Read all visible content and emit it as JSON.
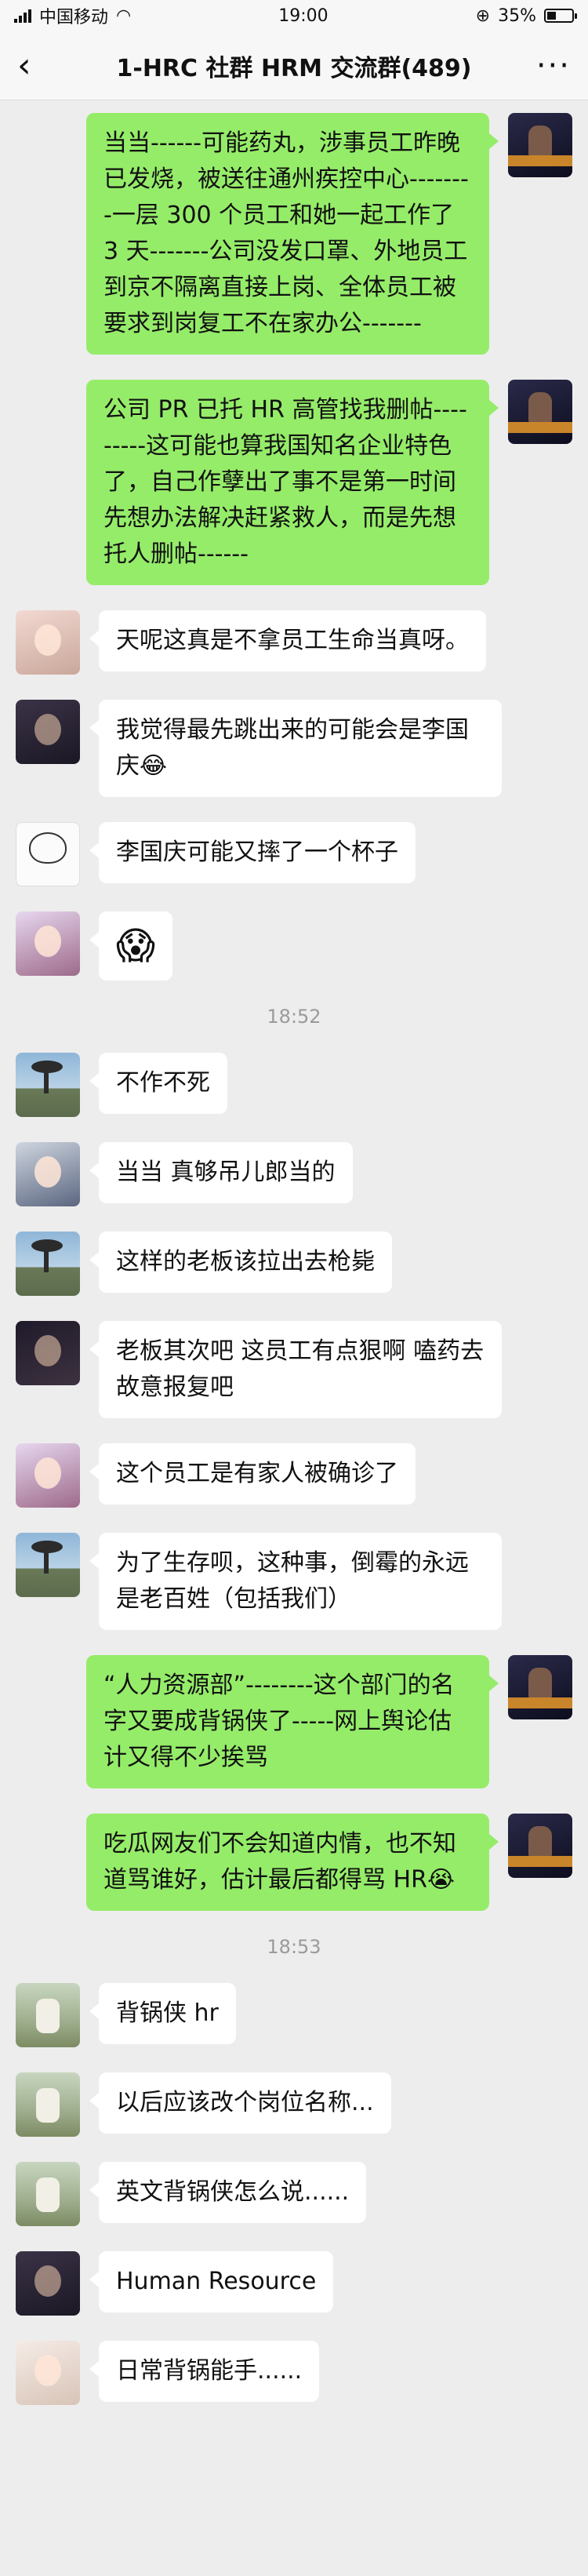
{
  "status_bar": {
    "carrier": "中国移动",
    "time": "19:00",
    "battery": "35%",
    "battery_level": 0.35
  },
  "nav": {
    "back_icon": "chevron-left-icon",
    "title": "1-HRC 社群 HRM 交流群(489)",
    "more_icon": "more-icon",
    "more_glyph": "···"
  },
  "messages": [
    {
      "side": "self",
      "avatar": "self",
      "text": "当当------可能药丸，涉事员工昨晚已发烧，被送往通州疾控中心--------一层 300 个员工和她一起工作了 3 天-------公司没发口罩、外地员工到京不隔离直接上岗、全体员工被要求到岗复工不在家办公-------"
    },
    {
      "side": "self",
      "avatar": "self",
      "text": "公司 PR 已托 HR 高管找我删帖---------这可能也算我国知名企业特色了，自己作孽出了事不是第一时间先想办法解决赶紧救人，而是先想托人删帖------"
    },
    {
      "side": "other",
      "avatar": "pink",
      "text": "天呢这真是不拿员工生命当真呀。"
    },
    {
      "side": "other",
      "avatar": "dark",
      "text": "我觉得最先跳出来的可能会是李国庆😂"
    },
    {
      "side": "other",
      "avatar": "white",
      "text": "李国庆可能又摔了一个杯子"
    },
    {
      "side": "other",
      "avatar": "purple",
      "text": "😱",
      "emoji": true
    },
    {
      "time": "18:52"
    },
    {
      "side": "other",
      "avatar": "tree",
      "text": "不作不死"
    },
    {
      "side": "other",
      "avatar": "baby",
      "text": "当当 真够吊儿郎当的"
    },
    {
      "side": "other",
      "avatar": "tree",
      "text": "这样的老板该拉出去枪毙"
    },
    {
      "side": "other",
      "avatar": "night",
      "text": "老板其次吧 这员工有点狠啊 嗑药去 故意报复吧"
    },
    {
      "side": "other",
      "avatar": "purple",
      "text": "这个员工是有家人被确诊了"
    },
    {
      "side": "other",
      "avatar": "tree",
      "text": "为了生存呗，这种事，倒霉的永远是老百姓（包括我们）"
    },
    {
      "side": "self",
      "avatar": "self",
      "text": "“人力资源部”--------这个部门的名字又要成背锅侠了-----网上舆论估计又得不少挨骂"
    },
    {
      "side": "self",
      "avatar": "self",
      "text": "吃瓜网友们不会知道内情，也不知道骂谁好，估计最后都得骂 HR😭"
    },
    {
      "time": "18:53"
    },
    {
      "side": "other",
      "avatar": "dog",
      "text": "背锅侠 hr"
    },
    {
      "side": "other",
      "avatar": "dog",
      "text": "以后应该改个岗位名称..."
    },
    {
      "side": "other",
      "avatar": "dog",
      "text": "英文背锅侠怎么说......"
    },
    {
      "side": "other",
      "avatar": "dark",
      "text": "Human Resource"
    },
    {
      "side": "other",
      "avatar": "woman",
      "text": "日常背锅能手......"
    }
  ]
}
